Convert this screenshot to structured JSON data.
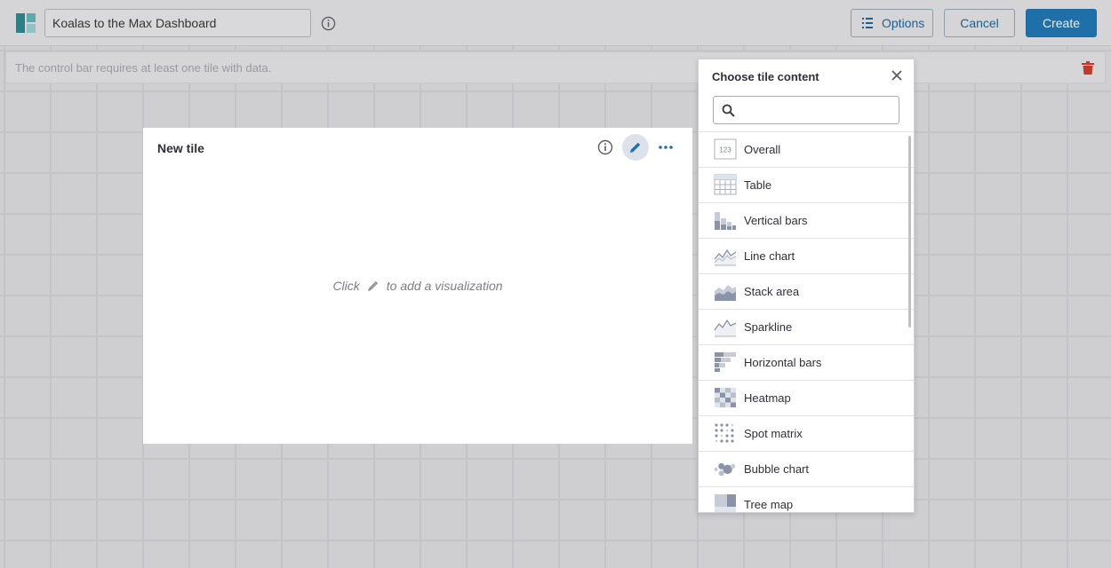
{
  "header": {
    "dashboard_title": "Koalas to the Max Dashboard",
    "options_label": "Options",
    "cancel_label": "Cancel",
    "create_label": "Create"
  },
  "control_bar": {
    "message": "The control bar requires at least one tile with data."
  },
  "tile": {
    "title": "New tile",
    "hint_before": "Click",
    "hint_after": "to add a visualization"
  },
  "panel": {
    "title": "Choose tile content",
    "search_value": "",
    "items": [
      {
        "label": "Overall",
        "icon": "overall-icon"
      },
      {
        "label": "Table",
        "icon": "table-icon"
      },
      {
        "label": "Vertical bars",
        "icon": "vertical-bars-icon"
      },
      {
        "label": "Line chart",
        "icon": "line-chart-icon"
      },
      {
        "label": "Stack area",
        "icon": "stack-area-icon"
      },
      {
        "label": "Sparkline",
        "icon": "sparkline-icon"
      },
      {
        "label": "Horizontal bars",
        "icon": "horizontal-bars-icon"
      },
      {
        "label": "Heatmap",
        "icon": "heatmap-icon"
      },
      {
        "label": "Spot matrix",
        "icon": "spot-matrix-icon"
      },
      {
        "label": "Bubble chart",
        "icon": "bubble-chart-icon"
      },
      {
        "label": "Tree map",
        "icon": "tree-map-icon"
      }
    ],
    "overall_icon_text": "123"
  },
  "colors": {
    "primary": "#1f70a8",
    "danger": "#c0392b",
    "icon_gray": "#8a93a8"
  }
}
